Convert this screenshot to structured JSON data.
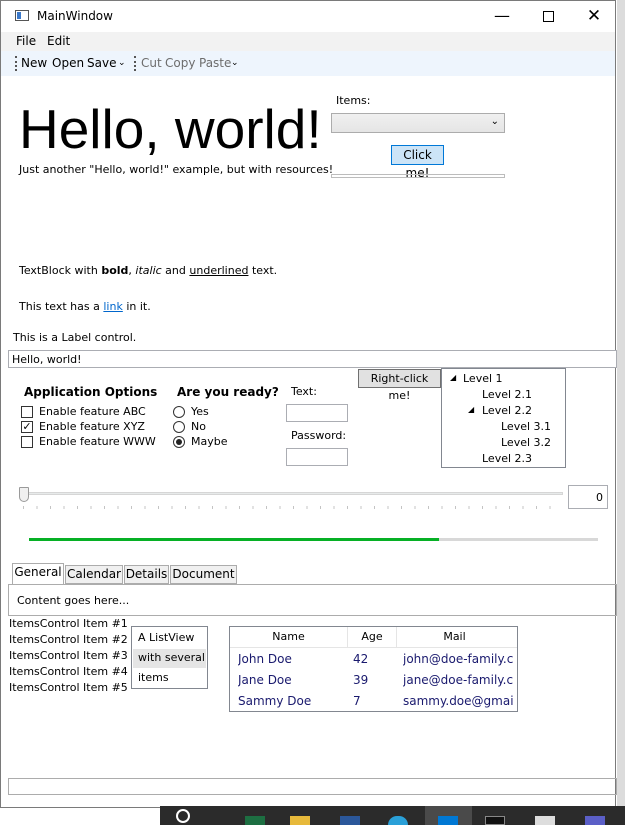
{
  "window": {
    "title": "MainWindow"
  },
  "menu": {
    "file": "File",
    "edit": "Edit"
  },
  "toolbar": {
    "new": "New",
    "open": "Open",
    "save": "Save",
    "cut": "Cut",
    "copy": "Copy",
    "paste": "Paste"
  },
  "header": {
    "hello": "Hello, world!",
    "subtitle": "Just another \"Hello, world!\" example, but with resources!",
    "items_label": "Items:",
    "click_button": "Click me!"
  },
  "textblock": {
    "p1": "TextBlock with ",
    "bold": "bold",
    "p2": ", ",
    "italic": "italic",
    "p3": " and ",
    "underlined": "underlined",
    "p4": " text."
  },
  "linkline": {
    "pre": "This text has a ",
    "link": "link",
    "post": " in it."
  },
  "label_control": "This is a Label control.",
  "textbox_value": "Hello, world!",
  "options": {
    "title": "Application Options",
    "items": [
      {
        "label": "Enable feature ABC",
        "checked": false
      },
      {
        "label": "Enable feature XYZ",
        "checked": true
      },
      {
        "label": "Enable feature WWW",
        "checked": false
      }
    ]
  },
  "ready": {
    "title": "Are you ready?",
    "items": [
      {
        "label": "Yes",
        "selected": false
      },
      {
        "label": "No",
        "selected": false
      },
      {
        "label": "Maybe",
        "selected": true
      }
    ]
  },
  "form": {
    "text_label": "Text:",
    "password_label": "Password:"
  },
  "context_button": "Right-click me!",
  "tree": [
    "Level 1",
    "Level 2.1",
    "Level 2.2",
    "Level 3.1",
    "Level 3.2",
    "Level 2.3"
  ],
  "slider": {
    "value_text": "0"
  },
  "progress": {
    "fraction": 0.72
  },
  "tabs": [
    "General",
    "Calendar",
    "Details",
    "Document"
  ],
  "tab_content": "Content goes here...",
  "items_control": [
    "ItemsControl Item #1",
    "ItemsControl Item #2",
    "ItemsControl Item #3",
    "ItemsControl Item #4",
    "ItemsControl Item #5"
  ],
  "listbox": [
    "A ListView",
    "with several",
    "items"
  ],
  "listview": {
    "columns": [
      "Name",
      "Age",
      "Mail"
    ],
    "rows": [
      [
        "John Doe",
        "42",
        "john@doe-family.cc"
      ],
      [
        "Jane Doe",
        "39",
        "jane@doe-family.cc"
      ],
      [
        "Sammy Doe",
        "7",
        "sammy.doe@gmail."
      ]
    ]
  },
  "colors": {
    "progress": "#06b025",
    "accent": "#0078d7",
    "toolbar_bg": "#eef5fd"
  }
}
